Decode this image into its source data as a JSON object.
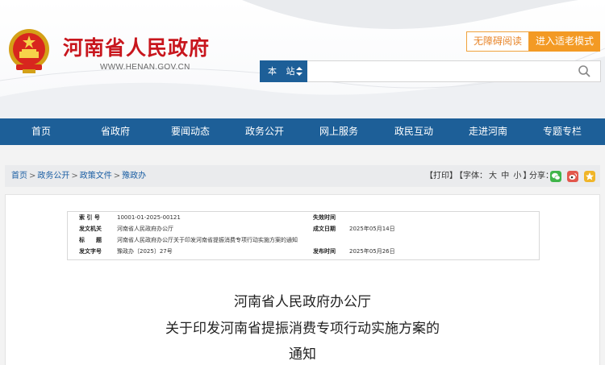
{
  "header": {
    "site_name": "河南省人民政府",
    "site_url": "WWW.HENAN.GOV.CN",
    "accessibility_label": "无障碍阅读",
    "elder_mode_label": "进入适老模式",
    "search_scope": "本 站",
    "search_value": "",
    "brand_red": "#c8161d",
    "nav_blue": "#1d5f98",
    "accent_orange": "#f39a24"
  },
  "nav": {
    "items": [
      {
        "label": "首页"
      },
      {
        "label": "省政府"
      },
      {
        "label": "要闻动态"
      },
      {
        "label": "政务公开"
      },
      {
        "label": "网上服务"
      },
      {
        "label": "政民互动"
      },
      {
        "label": "走进河南"
      },
      {
        "label": "专题专栏"
      }
    ]
  },
  "breadcrumb": {
    "items": [
      "首页",
      "政务公开",
      "政策文件",
      "豫政办"
    ],
    "separator": ">"
  },
  "tools": {
    "print": "【打印】",
    "font_prefix": "【字体：",
    "font_large": "大",
    "font_medium": "中",
    "font_small": "小",
    "font_suffix": "】",
    "share_label": "分享：",
    "share_icons": [
      "wechat-icon",
      "weibo-icon",
      "qzone-icon"
    ]
  },
  "meta": {
    "index_label": "索 引 号",
    "index_value": "10001-01-2025-00121",
    "expire_label": "失效时间",
    "expire_value": "",
    "issuer_label": "发文机关",
    "issuer_value": "河南省人民政府办公厅",
    "written_label": "成文日期",
    "written_value": "2025年05月14日",
    "title_label": "标　　题",
    "title_value": "河南省人民政府办公厅关于印发河南省提振消费专项行动实施方案的通知",
    "docno_label": "发文字号",
    "docno_value": "豫政办〔2025〕27号",
    "publish_label": "发布时间",
    "publish_value": "2025年05月26日"
  },
  "document": {
    "title_line1": "河南省人民政府办公厅",
    "title_line2": "关于印发河南省提振消费专项行动实施方案的",
    "title_line3": "通知"
  }
}
